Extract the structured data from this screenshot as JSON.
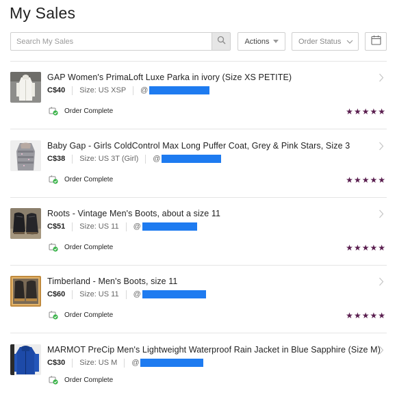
{
  "page": {
    "title": "My Sales"
  },
  "toolbar": {
    "search_placeholder": "Search My Sales",
    "actions_label": "Actions",
    "order_status_label": "Order Status"
  },
  "colors": {
    "rating": "#5a1e4f",
    "status_ok": "#3cb44b",
    "redacted": "#1e7bf0"
  },
  "sales": [
    {
      "title": "GAP Women's PrimaLoft Luxe Parka in ivory (Size XS PETITE)",
      "price": "C$40",
      "size": "Size: US XSP",
      "at": "@",
      "status": "Order Complete",
      "rating": 5,
      "thumb": "white-parka"
    },
    {
      "title": "Baby Gap - Girls ColdControl Max Long Puffer Coat, Grey & Pink Stars, Size 3",
      "price": "C$38",
      "size": "Size: US 3T (Girl)",
      "at": "@",
      "status": "Order Complete",
      "rating": 5,
      "thumb": "grey-puffer-coat"
    },
    {
      "title": "Roots - Vintage Men's Boots, about a size 11",
      "price": "C$51",
      "size": "Size: US 11",
      "at": "@",
      "status": "Order Complete",
      "rating": 5,
      "thumb": "black-boots"
    },
    {
      "title": "Timberland - Men's Boots, size 11",
      "price": "C$60",
      "size": "Size: US 11",
      "at": "@",
      "status": "Order Complete",
      "rating": 5,
      "thumb": "brown-boots-box"
    },
    {
      "title": "MARMOT PreCip Men's Lightweight Waterproof Rain Jacket in Blue Sapphire (Size M)",
      "price": "C$30",
      "size": "Size: US M",
      "at": "@",
      "status": "Order Complete",
      "rating": null,
      "thumb": "blue-rain-jacket"
    }
  ]
}
